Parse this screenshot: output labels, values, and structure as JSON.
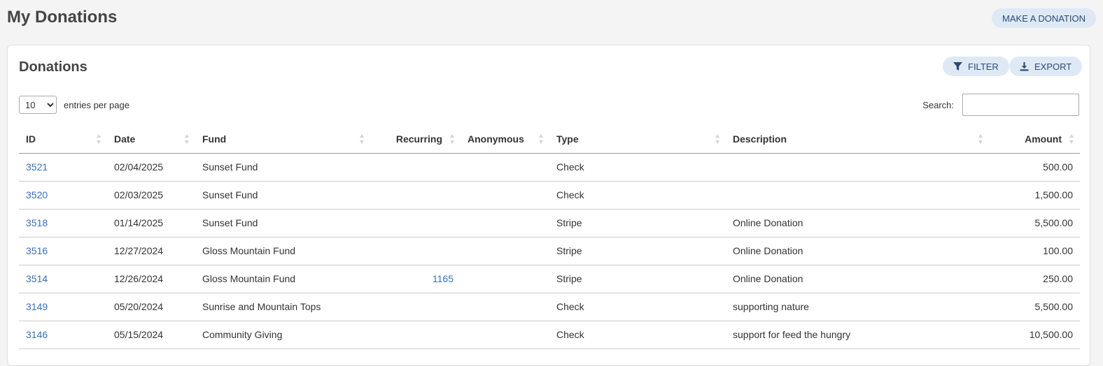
{
  "header": {
    "title": "My Donations",
    "make_donation_label": "MAKE A DONATION"
  },
  "card": {
    "title": "Donations",
    "filter_label": "FILTER",
    "export_label": "EXPORT",
    "entries_selected": "10",
    "entries_label": "entries per page",
    "search_label": "Search:",
    "search_value": ""
  },
  "table": {
    "columns": [
      "ID",
      "Date",
      "Fund",
      "Recurring",
      "Anonymous",
      "Type",
      "Description",
      "Amount"
    ],
    "rows": [
      {
        "id": "3521",
        "date": "02/04/2025",
        "fund": "Sunset Fund",
        "recurring": "",
        "anonymous": "",
        "type": "Check",
        "description": "",
        "amount": "500.00"
      },
      {
        "id": "3520",
        "date": "02/03/2025",
        "fund": "Sunset Fund",
        "recurring": "",
        "anonymous": "",
        "type": "Check",
        "description": "",
        "amount": "1,500.00"
      },
      {
        "id": "3518",
        "date": "01/14/2025",
        "fund": "Sunset Fund",
        "recurring": "",
        "anonymous": "",
        "type": "Stripe",
        "description": "Online Donation",
        "amount": "5,500.00"
      },
      {
        "id": "3516",
        "date": "12/27/2024",
        "fund": "Gloss Mountain Fund",
        "recurring": "",
        "anonymous": "",
        "type": "Stripe",
        "description": "Online Donation",
        "amount": "100.00"
      },
      {
        "id": "3514",
        "date": "12/26/2024",
        "fund": "Gloss Mountain Fund",
        "recurring": "1165",
        "anonymous": "",
        "type": "Stripe",
        "description": "Online Donation",
        "amount": "250.00"
      },
      {
        "id": "3149",
        "date": "05/20/2024",
        "fund": "Sunrise and Mountain Tops",
        "recurring": "",
        "anonymous": "",
        "type": "Check",
        "description": "supporting nature",
        "amount": "5,500.00"
      },
      {
        "id": "3146",
        "date": "05/15/2024",
        "fund": "Community Giving",
        "recurring": "",
        "anonymous": "",
        "type": "Check",
        "description": "support for feed the hungry",
        "amount": "10,500.00"
      }
    ]
  },
  "colors": {
    "accent_bg": "#dfe9f6",
    "accent_text": "#2b4a75",
    "link": "#3b6fb6"
  }
}
